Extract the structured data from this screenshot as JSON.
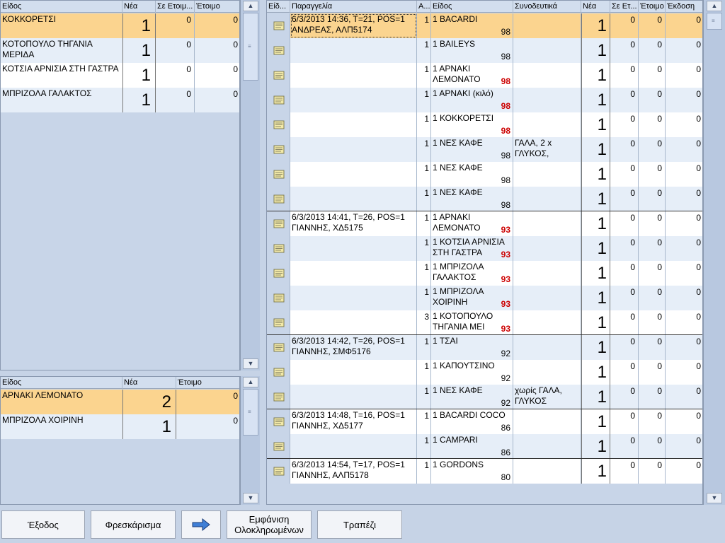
{
  "left_top": {
    "headers": [
      "Είδος",
      "Νέα",
      "Σε Ετοιμ...",
      "Έτοιμο"
    ],
    "rows": [
      {
        "item": "ΚΟΚΚΟΡΕΤΣΙ",
        "new": "1",
        "prep": "0",
        "ready": "0"
      },
      {
        "item": "ΚΟΤΟΠΟΥΛΟ ΤΗΓΑΝΙΑ ΜΕΡΙΔΑ",
        "new": "1",
        "prep": "0",
        "ready": "0"
      },
      {
        "item": "ΚΟΤΣΙΑ ΑΡΝΙΣΙΑ ΣΤΗ ΓΑΣΤΡΑ",
        "new": "1",
        "prep": "0",
        "ready": "0"
      },
      {
        "item": "ΜΠΡΙΖΟΛΑ ΓΑΛΑΚΤΟΣ",
        "new": "1",
        "prep": "0",
        "ready": "0"
      }
    ]
  },
  "left_bottom": {
    "headers": [
      "Είδος",
      "Νέα",
      "Έτοιμο"
    ],
    "rows": [
      {
        "item": "ΑΡΝΑΚΙ ΛΕΜΟΝΑΤΟ",
        "new": "2",
        "ready": "0"
      },
      {
        "item": "ΜΠΡΙΖΟΛΑ ΧΟΙΡΙΝΗ",
        "new": "1",
        "ready": "0"
      }
    ]
  },
  "right": {
    "headers": [
      "Είδ...",
      "Παραγγελία",
      "Α...",
      "Είδος",
      "Συνοδευτικά",
      "Νέα",
      "Σε Ετ...",
      "Έτοιμο",
      "Έκδοση"
    ],
    "rows": [
      {
        "order1": "6/3/2013 14:36, T=21, POS=1",
        "order2": "ΑΝΔΡΕΑΣ, ΑΛΠ5174",
        "a": "1",
        "item1": "1  BACARDI",
        "item2": "",
        "code": "98",
        "red": false,
        "side1": "",
        "side2": "",
        "new": "1",
        "prep": "0",
        "ready": "0",
        "ek": "0"
      },
      {
        "order1": "",
        "order2": "",
        "a": "1",
        "item1": "1  BAILEYS",
        "item2": "",
        "code": "98",
        "red": false,
        "side1": "",
        "side2": "",
        "new": "1",
        "prep": "0",
        "ready": "0",
        "ek": "0"
      },
      {
        "order1": "",
        "order2": "",
        "a": "1",
        "item1": "1  ΑΡΝΑΚΙ",
        "item2": "ΛΕΜΟΝΑΤΟ",
        "code": "98",
        "red": true,
        "side1": "",
        "side2": "",
        "new": "1",
        "prep": "0",
        "ready": "0",
        "ek": "0"
      },
      {
        "order1": "",
        "order2": "",
        "a": "1",
        "item1": "1  ΑΡΝΑΚΙ (κιλό)",
        "item2": "",
        "code": "98",
        "red": true,
        "side1": "",
        "side2": "",
        "new": "1",
        "prep": "0",
        "ready": "0",
        "ek": "0"
      },
      {
        "order1": "",
        "order2": "",
        "a": "1",
        "item1": "1  ΚΟΚΚΟΡΕΤΣΙ",
        "item2": "",
        "code": "98",
        "red": true,
        "side1": "",
        "side2": "",
        "new": "1",
        "prep": "0",
        "ready": "0",
        "ek": "0"
      },
      {
        "order1": "",
        "order2": "",
        "a": "1",
        "item1": "1  ΝΕΣ ΚΑΦΕ",
        "item2": "",
        "code": "98",
        "red": false,
        "side1": "ΓΑΛΑ, 2 x",
        "side2": "ΓΛΥΚΟΣ,",
        "new": "1",
        "prep": "0",
        "ready": "0",
        "ek": "0"
      },
      {
        "order1": "",
        "order2": "",
        "a": "1",
        "item1": "1  ΝΕΣ ΚΑΦΕ",
        "item2": "",
        "code": "98",
        "red": false,
        "side1": "",
        "side2": "",
        "new": "1",
        "prep": "0",
        "ready": "0",
        "ek": "0"
      },
      {
        "order1": "",
        "order2": "",
        "a": "1",
        "item1": "1  ΝΕΣ ΚΑΦΕ",
        "item2": "",
        "code": "98",
        "red": false,
        "side1": "",
        "side2": "",
        "new": "1",
        "prep": "0",
        "ready": "0",
        "ek": "0"
      },
      {
        "order1": "6/3/2013 14:41, T=26, POS=1",
        "order2": "ΓΙΑΝΝΗΣ, ΧΔ5175",
        "a": "1",
        "item1": "1  ΑΡΝΑΚΙ",
        "item2": "ΛΕΜΟΝΑΤΟ",
        "code": "93",
        "red": true,
        "side1": "",
        "side2": "",
        "new": "1",
        "prep": "0",
        "ready": "0",
        "ek": "0"
      },
      {
        "order1": "",
        "order2": "",
        "a": "1",
        "item1": "1  ΚΟΤΣΙΑ ΑΡΝΙΣΙΑ",
        "item2": "ΣΤΗ ΓΑΣΤΡΑ",
        "code": "93",
        "red": true,
        "side1": "",
        "side2": "",
        "new": "1",
        "prep": "0",
        "ready": "0",
        "ek": "0"
      },
      {
        "order1": "",
        "order2": "",
        "a": "1",
        "item1": "1  ΜΠΡΙΖΟΛΑ",
        "item2": "ΓΑΛΑΚΤΟΣ",
        "code": "93",
        "red": true,
        "side1": "",
        "side2": "",
        "new": "1",
        "prep": "0",
        "ready": "0",
        "ek": "0"
      },
      {
        "order1": "",
        "order2": "",
        "a": "1",
        "item1": "1  ΜΠΡΙΖΟΛΑ",
        "item2": "ΧΟΙΡΙΝΗ",
        "code": "93",
        "red": true,
        "side1": "",
        "side2": "",
        "new": "1",
        "prep": "0",
        "ready": "0",
        "ek": "0"
      },
      {
        "order1": "",
        "order2": "",
        "a": "3",
        "item1": "1  ΚΟΤΟΠΟΥΛΟ",
        "item2": "ΤΗΓΑΝΙΑ ΜΕΙ",
        "code": "93",
        "red": true,
        "side1": "",
        "side2": "",
        "new": "1",
        "prep": "0",
        "ready": "0",
        "ek": "0"
      },
      {
        "order1": "6/3/2013 14:42, T=26, POS=1",
        "order2": "ΓΙΑΝΝΗΣ, ΣΜΦ5176",
        "a": "1",
        "item1": "1  ΤΣΑΙ",
        "item2": "",
        "code": "92",
        "red": false,
        "side1": "",
        "side2": "",
        "new": "1",
        "prep": "0",
        "ready": "0",
        "ek": "0"
      },
      {
        "order1": "",
        "order2": "",
        "a": "1",
        "item1": "1  ΚΑΠΟΥΤΣΙΝΟ",
        "item2": "",
        "code": "92",
        "red": false,
        "side1": "",
        "side2": "",
        "new": "1",
        "prep": "0",
        "ready": "0",
        "ek": "0"
      },
      {
        "order1": "",
        "order2": "",
        "a": "1",
        "item1": "1  ΝΕΣ ΚΑΦΕ",
        "item2": "",
        "code": "92",
        "red": false,
        "side1": "χωρίς ΓΑΛΑ,",
        "side2": "ΓΛΥΚΟΣ",
        "new": "1",
        "prep": "0",
        "ready": "0",
        "ek": "0"
      },
      {
        "order1": "6/3/2013 14:48, T=16, POS=1",
        "order2": "ΓΙΑΝΝΗΣ, ΧΔ5177",
        "a": "1",
        "item1": "1  BACARDI COCO",
        "item2": "",
        "code": "86",
        "red": false,
        "side1": "",
        "side2": "",
        "new": "1",
        "prep": "0",
        "ready": "0",
        "ek": "0"
      },
      {
        "order1": "",
        "order2": "",
        "a": "1",
        "item1": "1  CAMPARI",
        "item2": "",
        "code": "86",
        "red": false,
        "side1": "",
        "side2": "",
        "new": "1",
        "prep": "0",
        "ready": "0",
        "ek": "0"
      },
      {
        "order1": "6/3/2013 14:54, T=17, POS=1",
        "order2": "ΓΙΑΝΝΗΣ, ΑΛΠ5178",
        "a": "1",
        "item1": "1  GORDONS",
        "item2": "",
        "code": "80",
        "red": false,
        "side1": "",
        "side2": "",
        "new": "1",
        "prep": "0",
        "ready": "0",
        "ek": "0"
      }
    ]
  },
  "buttons": {
    "exit": "Έξοδος",
    "refresh": "Φρεσκάρισμα",
    "show_completed_1": "Εμφάνιση",
    "show_completed_2": "Ολοκληρωμένων",
    "table": "Τραπέζι"
  },
  "icons": {
    "note": "note-icon",
    "arrow": "arrow-right-icon"
  },
  "colors": {
    "selected_row": "#fbd48f",
    "alt_row": "#e6eef8",
    "panel_bg": "#c8d5e8",
    "code_red": "#cc0000"
  }
}
